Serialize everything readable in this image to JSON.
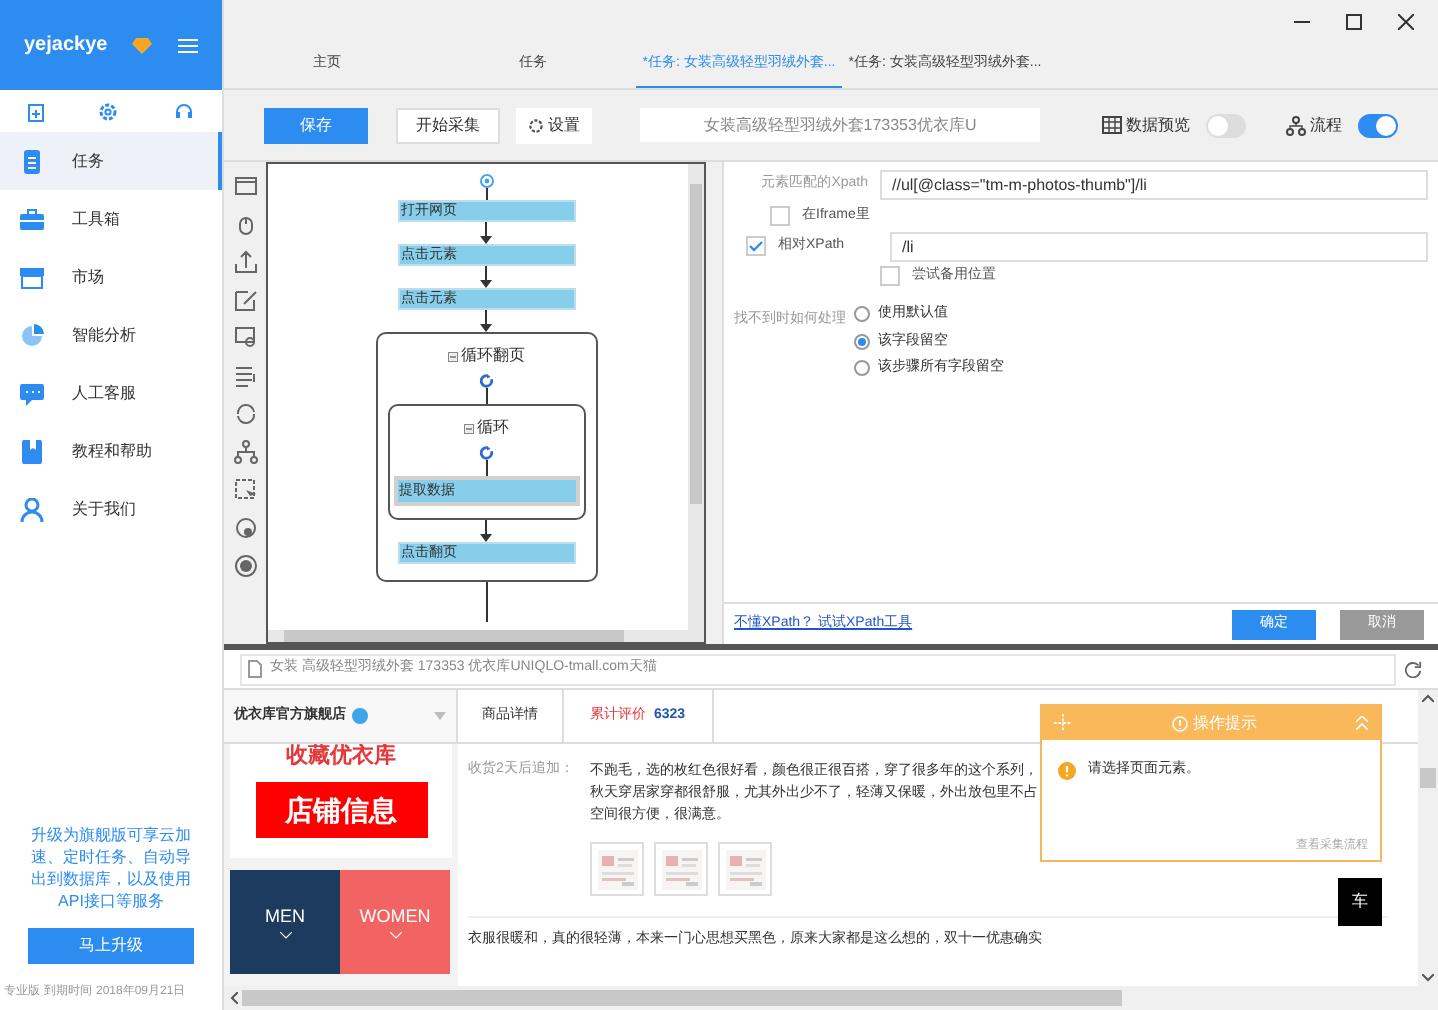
{
  "sidebar": {
    "user": "yejackye",
    "nav": [
      {
        "label": "任务",
        "selected": true
      },
      {
        "label": "工具箱",
        "selected": false
      },
      {
        "label": "市场",
        "selected": false
      },
      {
        "label": "智能分析",
        "selected": false
      },
      {
        "label": "人工客服",
        "selected": false
      },
      {
        "label": "教程和帮助",
        "selected": false
      },
      {
        "label": "关于我们",
        "selected": false
      }
    ],
    "promo": "升级为旗舰版可享云加速、定时任务、自动导出到数据库，以及使用API接口等服务",
    "upgrade_button": "马上升级",
    "edition": "专业版",
    "expiry_label": "到期时间",
    "expiry_date": "2018年09月21日"
  },
  "tabs": [
    {
      "label": "主页",
      "selected": false
    },
    {
      "label": "任务",
      "selected": false
    },
    {
      "label": "*任务: 女装高级轻型羽绒外套...",
      "selected": true
    },
    {
      "label": "*任务: 女装高级轻型羽绒外套...",
      "selected": false
    }
  ],
  "toolbar": {
    "save": "保存",
    "start": "开始采集",
    "settings": "设置",
    "task_name": "女装高级轻型羽绒外套173353优衣库U",
    "preview": {
      "label": "数据预览",
      "on": false
    },
    "flow": {
      "label": "流程",
      "on": true
    }
  },
  "flow": [
    {
      "kind": "action",
      "label": "打开网页"
    },
    {
      "kind": "action",
      "label": "点击元素"
    },
    {
      "kind": "action",
      "label": "点击元素"
    },
    {
      "kind": "loop",
      "label": "循环翻页",
      "children": [
        {
          "kind": "loop",
          "label": "循环",
          "children": [
            {
              "kind": "action",
              "label": "提取数据",
              "selected": true
            }
          ]
        },
        {
          "kind": "action",
          "label": "点击翻页"
        }
      ]
    }
  ],
  "settings": {
    "xpath_label": "元素匹配的Xpath",
    "xpath": "//ul[@class=\"tm-m-photos-thumb\"]/li",
    "checks": [
      {
        "label": "在Iframe里",
        "checked": false
      },
      {
        "label": "相对XPath",
        "checked": true,
        "value": "/li"
      },
      {
        "label": "尝试备用位置",
        "checked": false
      }
    ],
    "fallback_label": "找不到时如何处理",
    "fallback": [
      {
        "label": "使用默认值",
        "selected": false
      },
      {
        "label": "该字段留空",
        "selected": true
      },
      {
        "label": "该步骤所有字段留空",
        "selected": false
      }
    ],
    "help_link": "不懂XPath？ 试试XPath工具",
    "ok": "确定",
    "cancel": "取消"
  },
  "browser": {
    "address": "女装 高级轻型羽绒外套 173353 优衣库UNIQLO-tmall.com天猫",
    "store": "优衣库官方旗舰店",
    "store_tabs": [
      "商品详情"
    ],
    "reviews_label": "累计评价",
    "reviews_count": "6323",
    "fav": "收藏优衣库",
    "shop_info": "店铺信息",
    "men": "MEN",
    "women": "WOMEN",
    "review_label": "收货2天后追加：",
    "review_text": "不跑毛，选的枚红色很好看，颜色很正很百搭，穿了很多年的这个系列，秋天穿居家穿都很舒服，尤其外出少不了，轻薄又保暖，外出放包里不占空间很方便，很满意。",
    "review2": "衣服很暖和，真的很轻薄，本来一门心思想买黑色，原来大家都是这么想的，双十一优惠确实",
    "cart": "车"
  },
  "tip": {
    "title": "操作提示",
    "message": "请选择页面元素。",
    "link": "查看采集流程"
  }
}
